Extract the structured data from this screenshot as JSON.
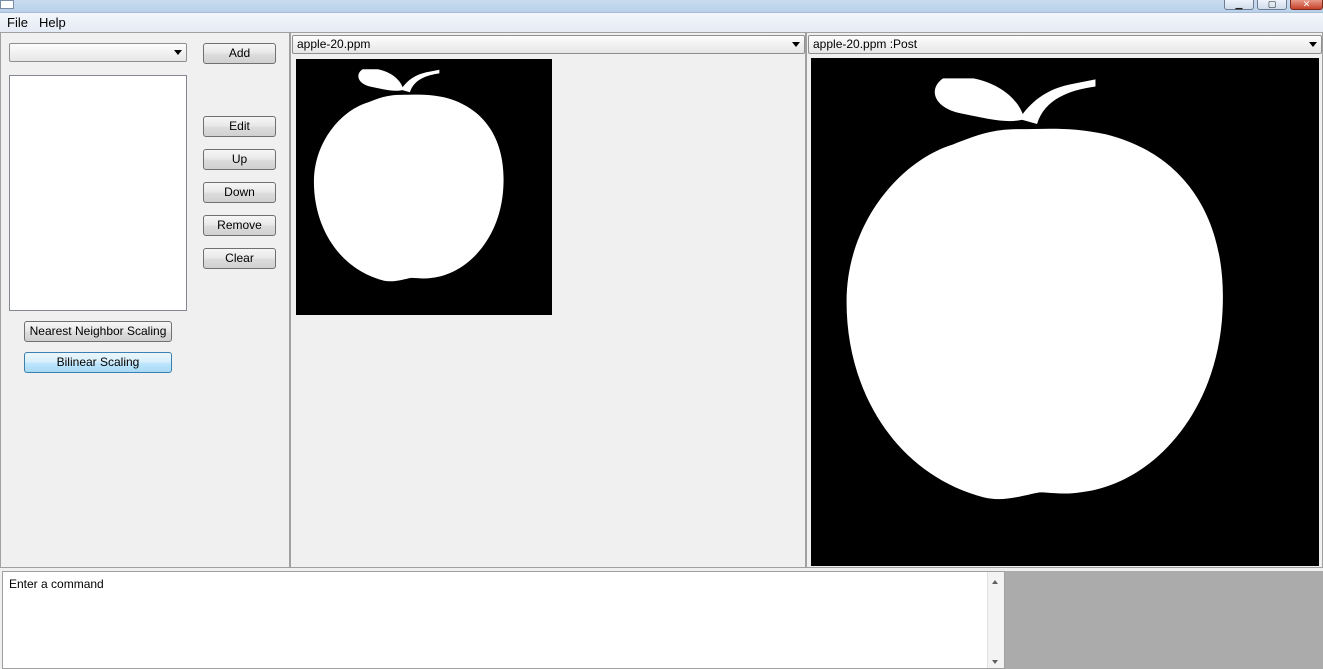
{
  "menu": {
    "file": "File",
    "help": "Help"
  },
  "window_controls": {
    "minimize": "▁",
    "maximize": "▢",
    "close": "✕"
  },
  "left": {
    "combo_value": "",
    "buttons": {
      "add": "Add",
      "edit": "Edit",
      "up": "Up",
      "down": "Down",
      "remove": "Remove",
      "clear": "Clear",
      "nearest": "Nearest Neighbor Scaling",
      "bilinear": "Bilinear Scaling"
    }
  },
  "middle": {
    "combo_value": "apple-20.ppm"
  },
  "right": {
    "combo_value": "apple-20.ppm :Post"
  },
  "console": {
    "placeholder": "Enter a command"
  },
  "colors": {
    "image_background": "#000000",
    "image_foreground": "#ffffff",
    "accent_button": "#a7d9f5"
  },
  "icons": {
    "dropdown": "chevron-down-icon",
    "apple": "apple-silhouette"
  }
}
